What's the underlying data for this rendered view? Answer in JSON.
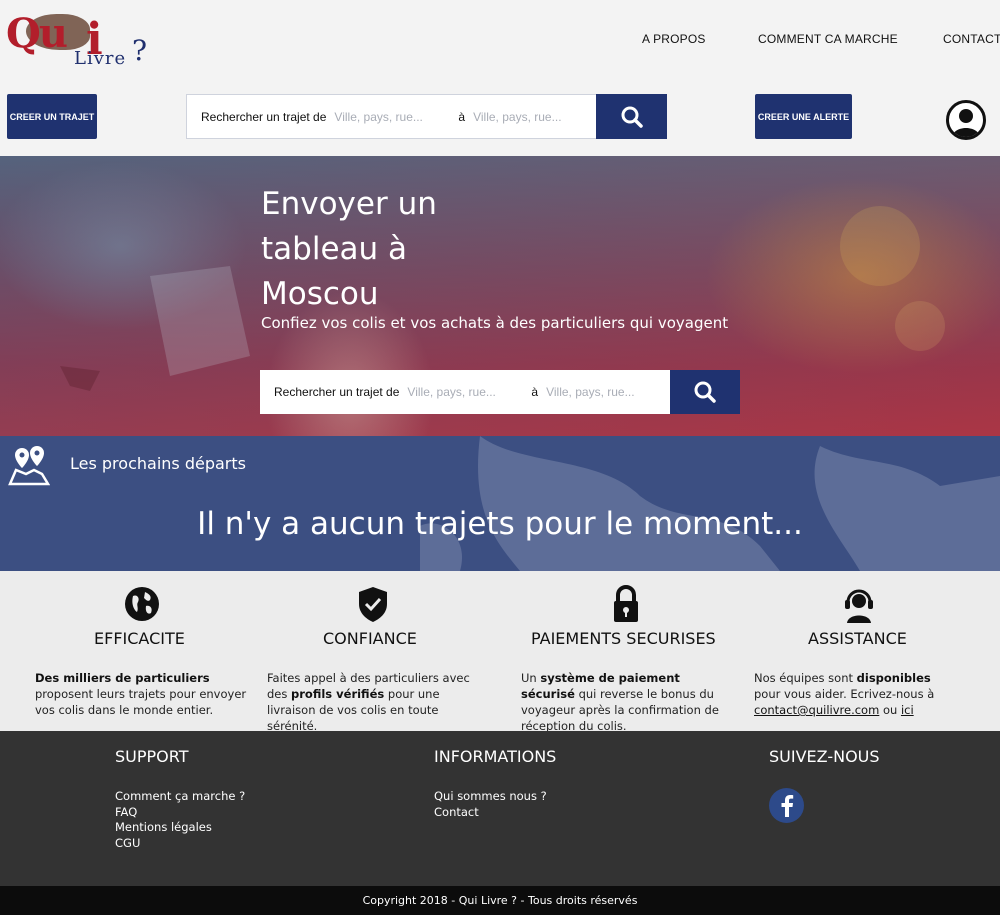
{
  "logo": {
    "q": "Qu",
    "i": "i",
    "livre": "Livre",
    "qm": "?"
  },
  "nav": {
    "apropos": "A PROPOS",
    "comment": "COMMENT CA MARCHE",
    "contact": "CONTACT"
  },
  "header": {
    "create_trip": "CREER UN TRAJET",
    "create_alert": "CREER UNE ALERTE",
    "search": {
      "label": "Rechercher un trajet de",
      "from_placeholder": "Ville, pays, rue...",
      "to_label": "à",
      "to_placeholder": "Ville, pays, rue..."
    }
  },
  "hero": {
    "title": "Envoyer un tableau à Moscou",
    "subtitle": "Confiez vos colis et vos achats à des particuliers qui voyagent",
    "search": {
      "label": "Rechercher un trajet de",
      "from_placeholder": "Ville, pays, rue...",
      "to_label": "à",
      "to_placeholder": "Ville, pays, rue..."
    }
  },
  "departures": {
    "title": "Les prochains départs",
    "message": "Il n'y a aucun trajets pour le moment..."
  },
  "features": [
    {
      "icon": "globe-icon",
      "title": "EFFICACITE",
      "bold": "Des milliers de particuliers",
      "text": "proposent leurs trajets pour envoyer vos colis dans le monde entier."
    },
    {
      "icon": "shield-check-icon",
      "title": "CONFIANCE",
      "pre": "Faites appel à des particuliers avec des",
      "bold": "profils vérifiés",
      "text": "pour une livraison de vos colis en toute sérénité."
    },
    {
      "icon": "padlock-icon",
      "title": "PAIEMENTS SECURISES",
      "pre": "Un",
      "bold": "système de paiement sécurisé",
      "text": "qui reverse le bonus du voyageur après la confirmation de réception du colis."
    },
    {
      "icon": "headset-icon",
      "title": "ASSISTANCE",
      "pre": "Nos équipes sont",
      "bold": "disponibles",
      "text": "pour vous aider. Ecrivez-nous à",
      "email": "contact@quilivre.com",
      "or": "ou",
      "here": "ici"
    }
  ],
  "footer": {
    "support": {
      "title": "SUPPORT",
      "links": [
        "Comment ça marche ?",
        "FAQ",
        "Mentions légales",
        "CGU"
      ]
    },
    "info": {
      "title": "INFORMATIONS",
      "links": [
        "Qui sommes nous ?",
        "Contact"
      ]
    },
    "follow": {
      "title": "SUIVEZ-NOUS",
      "icon": "facebook-icon"
    },
    "copyright": "Copyright 2018 - Qui Livre ? - Tous droits réservés"
  },
  "colors": {
    "primary": "#1f3270",
    "accent": "#b21e2b",
    "footer": "#333333",
    "band": "#3c4f82"
  }
}
